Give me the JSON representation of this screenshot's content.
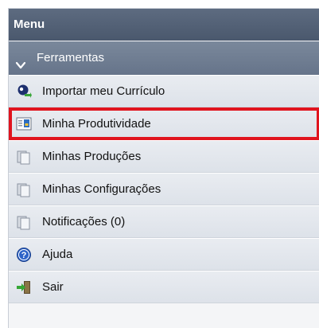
{
  "menu": {
    "title": "Menu",
    "section": {
      "label": "Ferramentas",
      "expanded": true,
      "items": [
        {
          "label": "Importar meu Currículo",
          "icon": "import-cv-icon"
        },
        {
          "label": "Minha Produtividade",
          "icon": "productivity-icon",
          "highlighted": true
        },
        {
          "label": "Minhas Produções",
          "icon": "documents-icon"
        },
        {
          "label": "Minhas Configurações",
          "icon": "documents-icon"
        },
        {
          "label": "Notificações (0)",
          "icon": "documents-icon"
        },
        {
          "label": "Ajuda",
          "icon": "help-icon"
        },
        {
          "label": "Sair",
          "icon": "exit-icon"
        }
      ]
    }
  },
  "colors": {
    "header_bg": "#4e5c71",
    "section_bg": "#6e7c90",
    "item_bg": "#e4e8ee",
    "highlight_border": "#e0141e"
  }
}
